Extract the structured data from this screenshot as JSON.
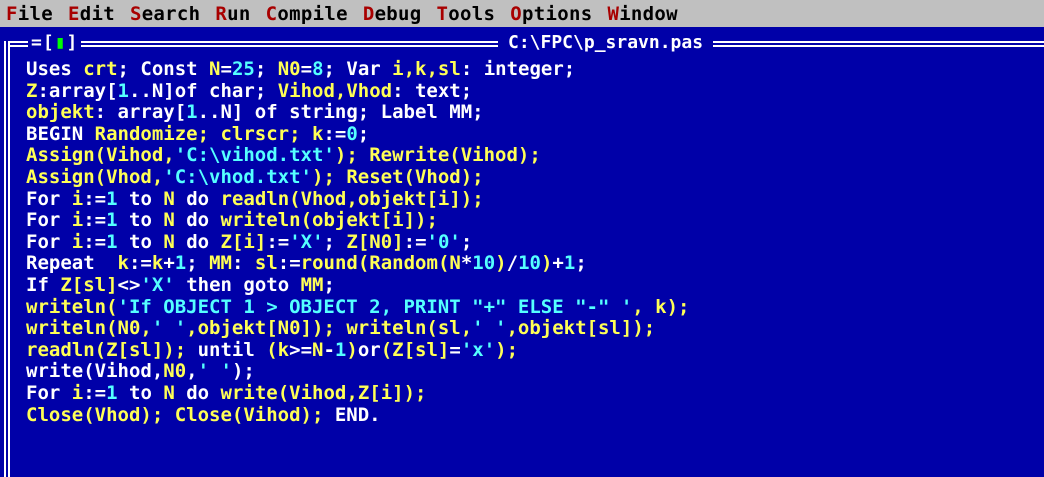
{
  "menu": {
    "items": [
      {
        "hot": "F",
        "rest": "ile"
      },
      {
        "hot": "E",
        "rest": "dit"
      },
      {
        "hot": "S",
        "rest": "earch"
      },
      {
        "hot": "R",
        "rest": "un"
      },
      {
        "hot": "C",
        "rest": "ompile"
      },
      {
        "hot": "D",
        "rest": "ebug"
      },
      {
        "hot": "T",
        "rest": "ools"
      },
      {
        "hot": "O",
        "rest": "ptions"
      },
      {
        "hot": "W",
        "rest": "indow"
      }
    ]
  },
  "window": {
    "close_box": "=[",
    "close_square": "▮",
    "close_end": "]",
    "title": "C:\\FPC\\p_sravn.pas"
  },
  "code_lines": [
    [
      [
        "kw",
        "Uses "
      ],
      [
        "id",
        "crt"
      ],
      [
        "kw",
        "; Const "
      ],
      [
        "id",
        "N"
      ],
      [
        "kw",
        "="
      ],
      [
        "num",
        "25"
      ],
      [
        "kw",
        "; "
      ],
      [
        "id",
        "N0"
      ],
      [
        "kw",
        "="
      ],
      [
        "num",
        "8"
      ],
      [
        "kw",
        "; Var "
      ],
      [
        "id",
        "i,k,sl"
      ],
      [
        "kw",
        ": integer;"
      ]
    ],
    [
      [
        "id",
        "Z"
      ],
      [
        "kw",
        ":array["
      ],
      [
        "num",
        "1"
      ],
      [
        "kw",
        "..N]of char; "
      ],
      [
        "id",
        "Vihod,Vhod"
      ],
      [
        "kw",
        ": text;"
      ]
    ],
    [
      [
        "id",
        "objekt"
      ],
      [
        "kw",
        ": array["
      ],
      [
        "num",
        "1"
      ],
      [
        "kw",
        "..N] of string; Label MM;"
      ]
    ],
    [
      [
        "kw",
        "BEGIN "
      ],
      [
        "id",
        "Randomize; clrscr; k"
      ],
      [
        "kw",
        ":="
      ],
      [
        "num",
        "0"
      ],
      [
        "kw",
        ";"
      ]
    ],
    [
      [
        "id",
        "Assign(Vihod,"
      ],
      [
        "str",
        "'C:\\vihod.txt'"
      ],
      [
        "id",
        "); Rewrite(Vihod);"
      ]
    ],
    [
      [
        "id",
        "Assign(Vhod,"
      ],
      [
        "str",
        "'C:\\vhod.txt'"
      ],
      [
        "id",
        "); Reset(Vhod);"
      ]
    ],
    [
      [
        "kw",
        "For "
      ],
      [
        "id",
        "i"
      ],
      [
        "kw",
        ":="
      ],
      [
        "num",
        "1"
      ],
      [
        "kw",
        " to "
      ],
      [
        "id",
        "N"
      ],
      [
        "kw",
        " do "
      ],
      [
        "id",
        "readln(Vhod,objekt[i]);"
      ]
    ],
    [
      [
        "kw",
        "For "
      ],
      [
        "id",
        "i"
      ],
      [
        "kw",
        ":="
      ],
      [
        "num",
        "1"
      ],
      [
        "kw",
        " to "
      ],
      [
        "id",
        "N"
      ],
      [
        "kw",
        " do "
      ],
      [
        "id",
        "writeln(objekt[i]);"
      ]
    ],
    [
      [
        "kw",
        "For "
      ],
      [
        "id",
        "i"
      ],
      [
        "kw",
        ":="
      ],
      [
        "num",
        "1"
      ],
      [
        "kw",
        " to "
      ],
      [
        "id",
        "N"
      ],
      [
        "kw",
        " do "
      ],
      [
        "id",
        "Z[i]"
      ],
      [
        "kw",
        ":="
      ],
      [
        "str",
        "'X'"
      ],
      [
        "kw",
        "; "
      ],
      [
        "id",
        "Z[N0]"
      ],
      [
        "kw",
        ":="
      ],
      [
        "str",
        "'0'"
      ],
      [
        "kw",
        ";"
      ]
    ],
    [
      [
        "kw",
        "Repeat  "
      ],
      [
        "id",
        "k"
      ],
      [
        "kw",
        ":="
      ],
      [
        "id",
        "k"
      ],
      [
        "kw",
        "+"
      ],
      [
        "num",
        "1"
      ],
      [
        "kw",
        "; "
      ],
      [
        "id",
        "MM"
      ],
      [
        "kw",
        ": "
      ],
      [
        "id",
        "sl"
      ],
      [
        "kw",
        ":="
      ],
      [
        "id",
        "round(Random(N"
      ],
      [
        "kw",
        "*"
      ],
      [
        "num",
        "10"
      ],
      [
        "id",
        ")"
      ],
      [
        "kw",
        "/"
      ],
      [
        "num",
        "10"
      ],
      [
        "id",
        ")"
      ],
      [
        "kw",
        "+"
      ],
      [
        "num",
        "1"
      ],
      [
        "kw",
        ";"
      ]
    ],
    [
      [
        "kw",
        "If "
      ],
      [
        "id",
        "Z[sl]"
      ],
      [
        "kw",
        "<>"
      ],
      [
        "str",
        "'X'"
      ],
      [
        "kw",
        " then goto "
      ],
      [
        "id",
        "MM"
      ],
      [
        "kw",
        ";"
      ]
    ],
    [
      [
        "id",
        "writeln("
      ],
      [
        "str",
        "'If OBJECT 1 > OBJECT 2, PRINT \"+\" ELSE \"-\" '"
      ],
      [
        "id",
        ", k);"
      ]
    ],
    [
      [
        "id",
        "writeln(N0,"
      ],
      [
        "str",
        "' '"
      ],
      [
        "id",
        ",objekt[N0]); writeln(sl,"
      ],
      [
        "str",
        "' '"
      ],
      [
        "id",
        ",objekt[sl]);"
      ]
    ],
    [
      [
        "id",
        "readln(Z[sl]);"
      ],
      [
        "kw",
        " until "
      ],
      [
        "id",
        "(k"
      ],
      [
        "kw",
        ">="
      ],
      [
        "id",
        "N"
      ],
      [
        "kw",
        "-"
      ],
      [
        "num",
        "1"
      ],
      [
        "id",
        ")"
      ],
      [
        "kw",
        "or"
      ],
      [
        "id",
        "(Z[sl]"
      ],
      [
        "kw",
        "="
      ],
      [
        "str",
        "'x'"
      ],
      [
        "id",
        ");"
      ]
    ],
    [
      [
        "kw",
        "write(Vihod,"
      ],
      [
        "id",
        "N0"
      ],
      [
        "kw",
        ","
      ],
      [
        "str",
        "' '"
      ],
      [
        "kw",
        ");"
      ]
    ],
    [
      [
        "kw",
        "For "
      ],
      [
        "id",
        "i"
      ],
      [
        "kw",
        ":="
      ],
      [
        "num",
        "1"
      ],
      [
        "kw",
        " to "
      ],
      [
        "id",
        "N"
      ],
      [
        "kw",
        " do "
      ],
      [
        "id",
        "write(Vihod,Z[i]);"
      ]
    ],
    [
      [
        "id",
        "Close(Vhod); Close(Vihod);"
      ],
      [
        "kw",
        " END."
      ]
    ]
  ],
  "colors": {
    "background": "#0000a8",
    "menubar": "#c0c0c0",
    "hotkey": "#a80000",
    "keyword": "#ffffff",
    "identifier": "#ffff55",
    "literal": "#55ffff"
  }
}
